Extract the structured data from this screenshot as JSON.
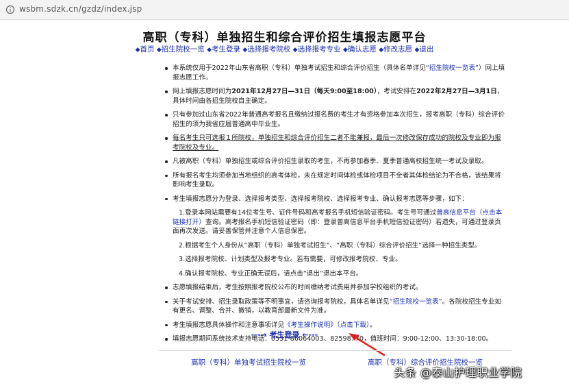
{
  "browser": {
    "url": "wsbm.sdzk.cn/gzdz/index.jsp"
  },
  "page": {
    "title": "高职（专科）单独招生和综合评价招生填报志愿平台"
  },
  "nav": [
    "首页",
    "招生院校一览",
    "考生登录",
    "选择报考院校",
    "选择报考专业",
    "确认志愿",
    "修改志愿",
    "退出"
  ],
  "notice": {
    "b1_pre": "本系统仅用于2022年山东省高职（专科）单独考试招生和综合评价招生（具体名单详见",
    "b1_link": "“招生院校一览表”",
    "b1_post": "）网上填报志愿工作。",
    "b2_pre": "网上填报志愿时间为",
    "b2_bold1": "2021年12月27日—31日（每天9:00至18:00）",
    "b2_mid": "，考试安排在",
    "b2_bold2": "2022年2月27日—3月1日",
    "b2_post": "，具体时间由各招生院校自主确定。",
    "b3": "只有参加过山东省2022年普通高考报名且缴纳过报名费的考生才有资格参加本次招生，报考高职（专科）综合评价招生的须为我省应届普通高中毕业生。",
    "b4": "每名考生只可选报１所院校，单独招生和综合评价招生二者不能兼报，最后一次修改保存成功的院校及专业即为报考院校及专业。",
    "b5": "凡被高职（专科）单独招生或综合评价招生录取的考生，不再参加春季、夏季普通高校招生统一考试及录取。",
    "b6": "所有报名考生均须参加当地组织的高考体检，未在规定时间体检或体检项目不全者其体检结论为不合格，该结果将影响考生录取。",
    "b7": "考生填报志愿分为登录、选择报考类型、选择报考院校、选择报考专业、确认报考志愿等步骤，如下：",
    "s1_pre": "1.登录本网站需要有14位考生号、证件号码和高考报名手机短信验证密码。考生号可通过",
    "s1_link": "普高信息平台（点击本链接打开）",
    "s1_post": "查询。高考报名手机短信验证密码（即：登录普高信息平台手机短信验证密码）若遗失，可通过登录页面再次发送。请妥善保管并注意个人信息保密。",
    "s2": "2.根据考生个人身份从“高职（专科）单独考试招生”、“高职（专科）综合评价招生”选择一种招生类型。",
    "s3": "3.选择报考院校、计划类型及报考专业。若有需要，可修改报考院校、专业。",
    "s4": "4.确认报考院校、专业正确无误后，请点击“退出”退出本平台。",
    "b8": "志愿填报结束后，考生按照报考院校公布的时间缴纳考试费用并参加学校组织的考试。",
    "b9_pre": "关于考试安排、招生录取政策等不明事宜，请咨询报考院校，具体名单详见",
    "b9_link": "“招生院校一览表”",
    "b9_post": "。各院校招生专业如有更名、调整、合并、撤销，以教育部最新文件为准。",
    "b10_pre": "考生填报志愿具体操作和注意事项详见",
    "b10_link": "《考生操作说明》（点击下载）",
    "b10_post": "。",
    "b11": "填报志愿期间系统技术支持电话：0531-86064003、82598770，值班时间：9:00-12:00、13:30-18:00。"
  },
  "login": {
    "left": "---→",
    "label": "考生登录",
    "right": "←---"
  },
  "footer": {
    "left": "高职（专科）单独考试招生院校一览",
    "right": "高职（专科）综合评价招生院校一览"
  },
  "watermark": "头条 @泰山护理职业学院",
  "colors": {
    "link": "#1a2fb0",
    "arrow": "#e0201c"
  }
}
